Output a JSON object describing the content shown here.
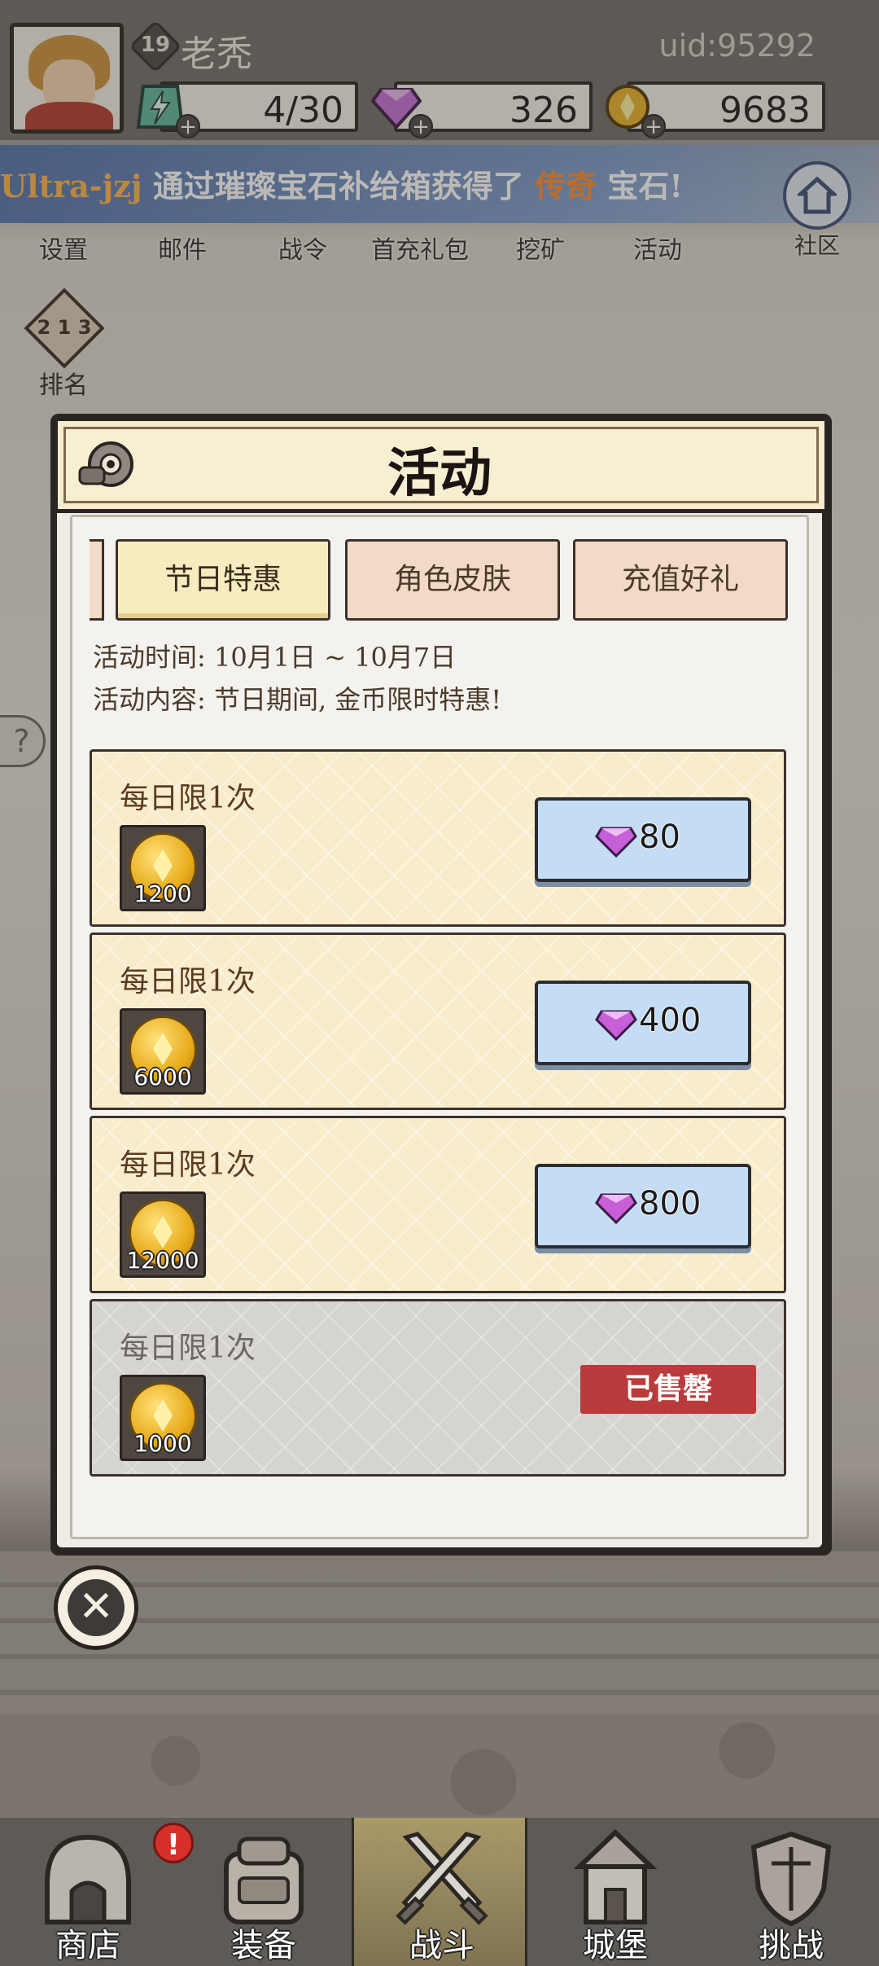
{
  "header": {
    "level": "19",
    "player_name": "老秃",
    "uid": "uid:95292",
    "resources": {
      "energy": "4/30",
      "gems": "326",
      "gold": "9683"
    }
  },
  "ticker": {
    "name": "Ultra-jzj",
    "text_before": "通过璀璨宝石补给箱获得了",
    "highlight": "传奇",
    "text_after": "宝石!"
  },
  "top_menu": {
    "items": [
      {
        "label": "设置",
        "icon": "gear-icon"
      },
      {
        "label": "邮件",
        "icon": "mail-icon"
      },
      {
        "label": "战令",
        "icon": "pass-icon"
      },
      {
        "label": "首充礼包",
        "icon": "gift-icon"
      },
      {
        "label": "挖矿",
        "icon": "pickaxe-icon"
      },
      {
        "label": "活动",
        "icon": "event-icon"
      }
    ],
    "community_label": "社区",
    "rank_label": "排名",
    "rank_nums": "2 1 3"
  },
  "dialog": {
    "title": "活动",
    "tabs": [
      {
        "label": "节日特惠",
        "active": true
      },
      {
        "label": "角色皮肤",
        "active": false
      },
      {
        "label": "充值好礼",
        "active": false
      }
    ],
    "time_line": "活动时间: 10月1日 ~ 10月7日",
    "content_line": "活动内容: 节日期间, 金币限时特惠!",
    "offers": [
      {
        "limit": "每日限1次",
        "amount": "1200",
        "price": "80",
        "sold_out": false
      },
      {
        "limit": "每日限1次",
        "amount": "6000",
        "price": "400",
        "sold_out": false
      },
      {
        "limit": "每日限1次",
        "amount": "12000",
        "price": "800",
        "sold_out": false
      },
      {
        "limit": "每日限1次",
        "amount": "1000",
        "price": "",
        "sold_out": true,
        "sold_out_label": "已售罄"
      }
    ]
  },
  "bottom_nav": {
    "items": [
      {
        "label": "商店",
        "icon": "shop-icon"
      },
      {
        "label": "装备",
        "icon": "backpack-icon"
      },
      {
        "label": "战斗",
        "icon": "crossed-swords-icon",
        "active": true
      },
      {
        "label": "城堡",
        "icon": "castle-icon"
      },
      {
        "label": "挑战",
        "icon": "shield-icon"
      }
    ],
    "alert": "!"
  },
  "colors": {
    "accent_orange": "#ff8a2a",
    "soldout_red": "#b93b3b",
    "price_button_blue": "#c5dcf5",
    "card_cream": "#f8eccb"
  }
}
